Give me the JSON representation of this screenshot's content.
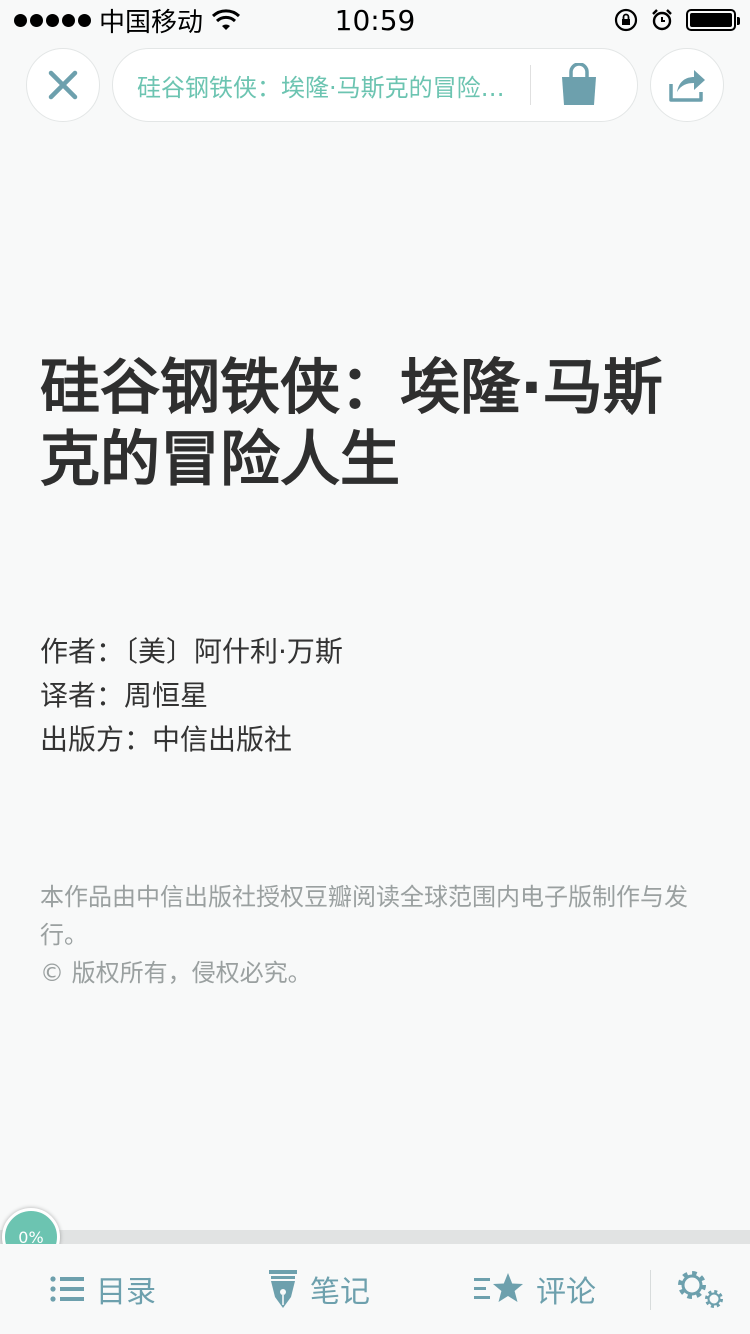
{
  "status_bar": {
    "carrier": "中国移动",
    "time": "10:59"
  },
  "toolbar": {
    "pill_title": "硅谷钢铁侠：埃隆·马斯克的冒险人生"
  },
  "book": {
    "title": "硅谷钢铁侠：埃隆·马斯克的冒险人生",
    "author": "作者：〔美〕阿什利·万斯",
    "translator": "译者：周恒星",
    "publisher": "出版方：中信出版社",
    "rights_line1": "本作品由中信出版社授权豆瓣阅读全球范围内电子版制作与发行。",
    "rights_line2": "© 版权所有，侵权必究。"
  },
  "progress": {
    "label": "0%",
    "value": 0
  },
  "bottom_bar": {
    "toc_label": "目录",
    "notes_label": "笔记",
    "review_label": "评论"
  },
  "colors": {
    "accent": "#6cc4b1",
    "icon": "#6da0ad",
    "background": "#f8f9f9"
  },
  "icons": [
    "signal-dots-icon",
    "wifi-icon",
    "rotation-lock-icon",
    "alarm-icon",
    "battery-icon",
    "close-icon",
    "shopping-bag-icon",
    "share-icon",
    "list-icon",
    "pen-nib-icon",
    "star-list-icon",
    "gear-icon"
  ]
}
